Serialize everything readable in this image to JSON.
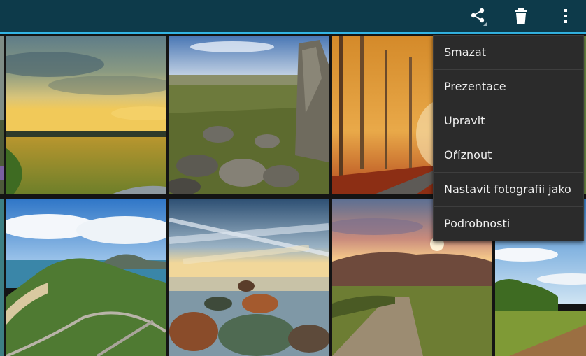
{
  "actionbar": {
    "icons": [
      "share-icon",
      "trash-icon",
      "overflow-menu-icon"
    ],
    "background": "#0d3a4a",
    "accent": "#33b5e5"
  },
  "gallery": {
    "thumbnails": [
      "sunset-meadow-photo",
      "rocky-hillside-photo",
      "autumn-forest-road-photo",
      "green-hills-photo-partial",
      "coastal-island-photo",
      "cloudy-sea-rocks-photo",
      "sunset-valley-path-photo",
      "green-field-photo"
    ]
  },
  "menu": {
    "items": [
      "Smazat",
      "Prezentace",
      "Upravit",
      "Oříznout",
      "Nastavit fotografii jako",
      "Podrobnosti"
    ]
  }
}
